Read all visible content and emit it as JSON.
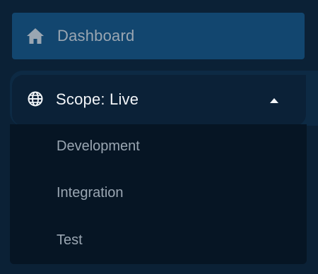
{
  "nav": {
    "dashboard": {
      "label": "Dashboard",
      "icon": "home-icon"
    }
  },
  "scope": {
    "label": "Scope: Live",
    "icon": "globe-icon",
    "expanded": true,
    "options": [
      {
        "label": "Development"
      },
      {
        "label": "Integration"
      },
      {
        "label": "Test"
      }
    ]
  },
  "colors": {
    "background": "#0b2136",
    "active_item": "#12466f",
    "submenu_bg": "#061524",
    "text_muted": "#9aa6b2",
    "text_bright": "#f2f5f8"
  }
}
